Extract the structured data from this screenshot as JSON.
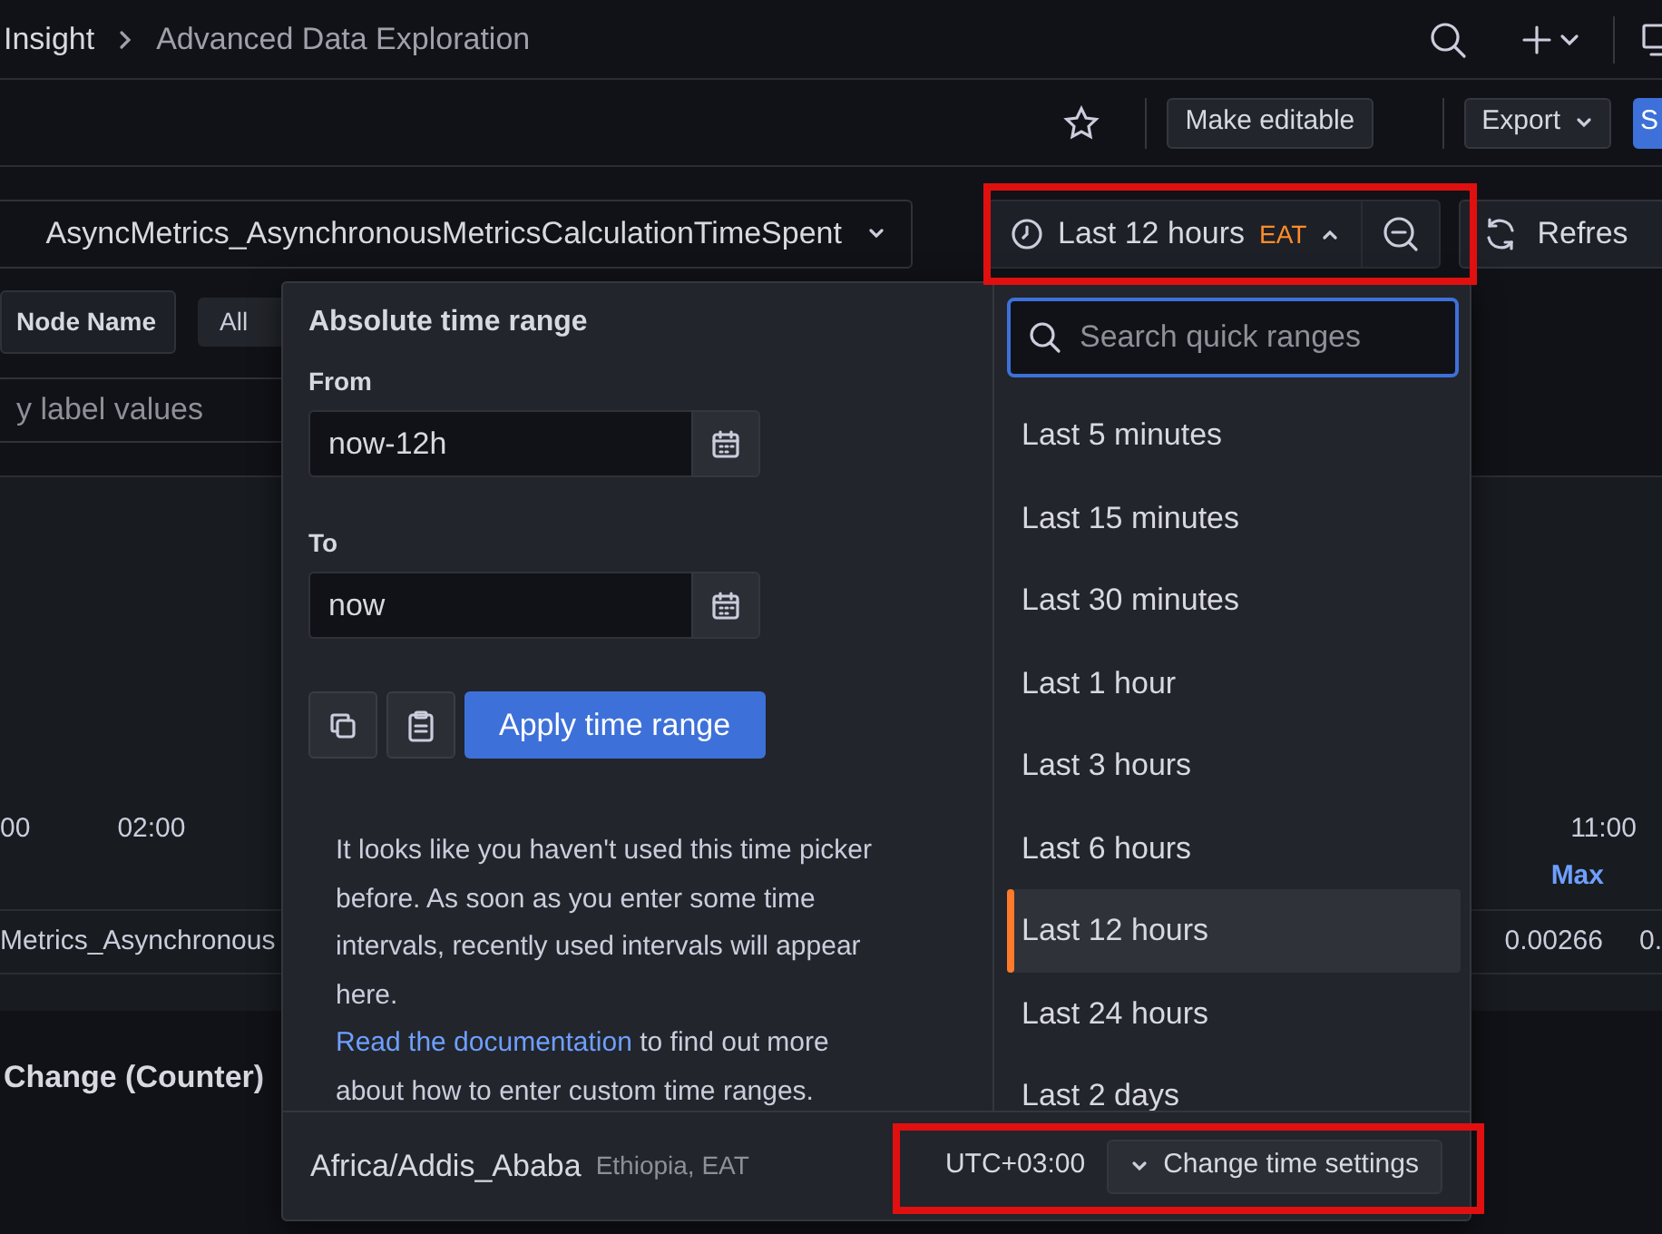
{
  "breadcrumbs": [
    {
      "label": "Insight"
    },
    {
      "label": "Advanced Data Exploration"
    }
  ],
  "toolbar": {
    "buttons": [
      {
        "label": "Make editable",
        "kind": "plain"
      },
      {
        "label": "Export",
        "kind": "dropdown"
      },
      {
        "label": "S",
        "kind": "primary"
      }
    ]
  },
  "variables": {
    "metric": "AsyncMetrics_AsynchronousMetricsCalculationTimeSpent",
    "node_label": "Node Name",
    "node_value": "All",
    "filter_placeholder": "y label values"
  },
  "time_picker": {
    "label": "Last 12 hours",
    "timezone": "EAT",
    "expanded": true,
    "highlighted": true
  },
  "refresh": {
    "label": "Refres"
  },
  "chart": {
    "x_labels": [
      "00",
      "02:00",
      "11:00"
    ],
    "legend_header": "Max",
    "legend_name": "Metrics_Asynchronous",
    "legend_values": [
      "0.00266",
      "0."
    ]
  },
  "panel_title": "Change (Counter)",
  "popover": {
    "title": "Absolute time range",
    "from_label": "From",
    "from_value": "now-12h",
    "to_label": "To",
    "to_value": "now",
    "apply_label": "Apply time range",
    "help_text": "It looks like you haven't used this time picker before. As soon as you enter some time intervals, recently used intervals will appear here.",
    "help_link": "Read the documentation",
    "help_after": "to find out more about how to enter custom time ranges.",
    "search_placeholder": "Search quick ranges",
    "quick_ranges": [
      {
        "label": "Last 5 minutes",
        "selected": false
      },
      {
        "label": "Last 15 minutes",
        "selected": false
      },
      {
        "label": "Last 30 minutes",
        "selected": false
      },
      {
        "label": "Last 1 hour",
        "selected": false
      },
      {
        "label": "Last 3 hours",
        "selected": false
      },
      {
        "label": "Last 6 hours",
        "selected": false
      },
      {
        "label": "Last 12 hours",
        "selected": true
      },
      {
        "label": "Last 24 hours",
        "selected": false
      },
      {
        "label": "Last 2 days",
        "selected": false
      }
    ],
    "footer": {
      "zone": "Africa/Addis_Ababa",
      "zone_detail": "Ethiopia, EAT",
      "offset": "UTC+03:00",
      "settings_label": "Change time settings",
      "highlighted": true
    }
  }
}
